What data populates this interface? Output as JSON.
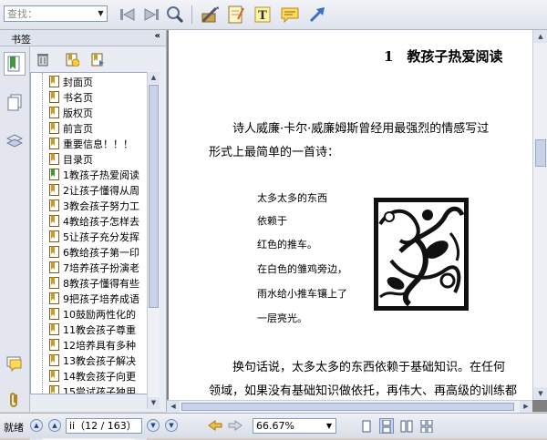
{
  "toolbar": {
    "search_placeholder": "查找：",
    "icons": [
      "find-prev-icon",
      "find-next-icon",
      "search-icon",
      "pencil-icon",
      "note-pad-icon",
      "text-tool-icon",
      "comment-icon",
      "arrow-tool-icon"
    ]
  },
  "sidebar": {
    "title": "书签",
    "collapse_glyph": "«",
    "bookmarks": [
      {
        "label": "封面页",
        "active": false
      },
      {
        "label": "书名页",
        "active": false
      },
      {
        "label": "版权页",
        "active": false
      },
      {
        "label": "前言页",
        "active": false
      },
      {
        "label": "重要信息！！！",
        "active": false
      },
      {
        "label": "目录页",
        "active": false
      },
      {
        "label": "1教孩子热爱阅读",
        "active": true
      },
      {
        "label": "2让孩子懂得从周",
        "active": false
      },
      {
        "label": "3教会孩子努力工",
        "active": false
      },
      {
        "label": "4教给孩子怎样去",
        "active": false
      },
      {
        "label": "5让孩子充分发挥",
        "active": false
      },
      {
        "label": "6教给孩子第一印",
        "active": false
      },
      {
        "label": "7培养孩子扮演老",
        "active": false
      },
      {
        "label": "8教孩子懂得有些",
        "active": false
      },
      {
        "label": "9把孩子培养成语",
        "active": false
      },
      {
        "label": "10鼓励两性化的",
        "active": false
      },
      {
        "label": "11教会孩子尊重",
        "active": false
      },
      {
        "label": "12培养具有多种",
        "active": false
      },
      {
        "label": "13教会孩子解决",
        "active": false
      },
      {
        "label": "14教会孩子向更",
        "active": false
      },
      {
        "label": "15尝试孩子独用",
        "active": false
      }
    ]
  },
  "document": {
    "heading": "1　教孩子热爱阅读",
    "para1_line1": "诗人威廉·卡尔·威廉姆斯曾经用最强烈的情感写过",
    "para1_line2": "形式上最简单的一首诗：",
    "poem": [
      "太多太多的东西",
      "依赖于",
      "红色的推车。",
      "在白色的雏鸡旁边，",
      "雨水给小推车镶上了",
      "一层亮光。"
    ],
    "para2_line1": "换句话说，太多太多的东西依赖于基础知识。在任何",
    "para2_line2": "领域，如果没有基础知识做依托，再伟大、再高级的训练都"
  },
  "statusbar": {
    "status": "就绪",
    "page_field": "ii（12 / 163）",
    "current_page": 12,
    "total_pages": 163,
    "zoom": "66.67%"
  },
  "colors": {
    "accent": "#3a5fb0",
    "chrome": "#dfe3ec",
    "bookmark_gold": "#c89b2e",
    "bookmark_active": "#3c9a3c"
  }
}
